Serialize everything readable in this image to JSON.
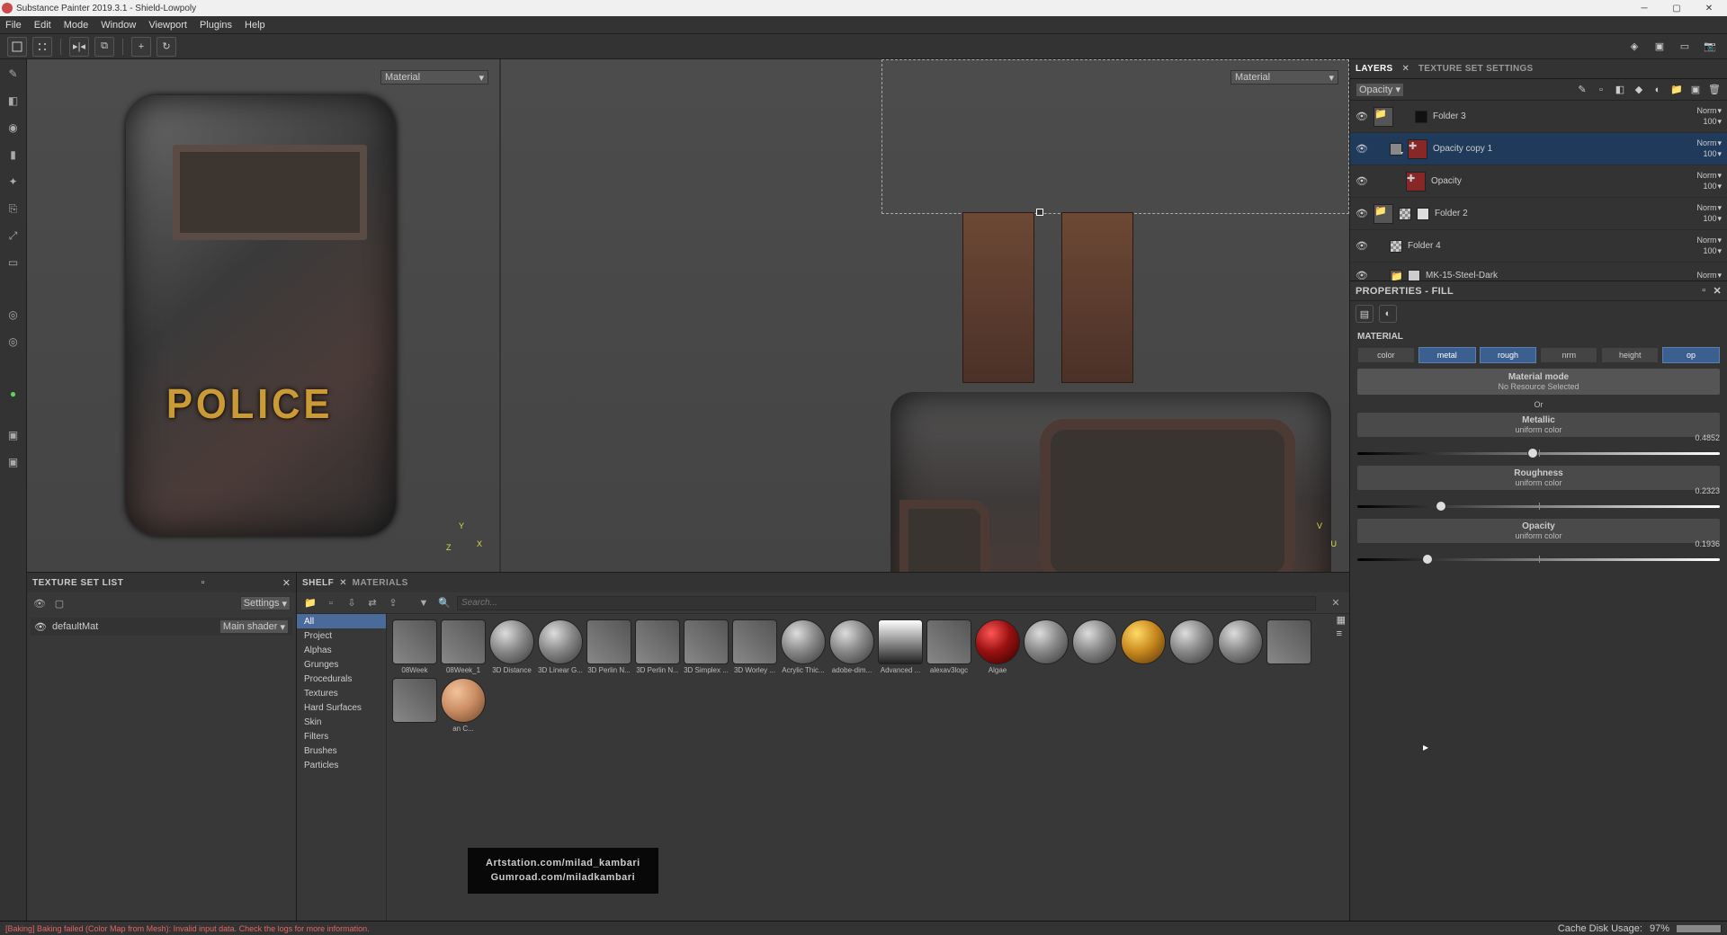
{
  "title_bar": {
    "title": "Substance Painter 2019.3.1 - Shield-Lowpoly"
  },
  "menu": [
    "File",
    "Edit",
    "Mode",
    "Window",
    "Viewport",
    "Plugins",
    "Help"
  ],
  "viewport": {
    "dropdown_left": "Material",
    "dropdown_right": "Material"
  },
  "right_tabs": {
    "layers": "LAYERS",
    "texset": "TEXTURE SET SETTINGS"
  },
  "blend_mode": "Opacity",
  "layers": [
    {
      "name": "Folder 3",
      "blend": "Norm",
      "opacity": "100",
      "type": "folder",
      "sel": false
    },
    {
      "name": "Opacity copy 1",
      "blend": "Norm",
      "opacity": "100",
      "type": "fill",
      "sel": true
    },
    {
      "name": "Opacity",
      "blend": "Norm",
      "opacity": "100",
      "type": "fill",
      "sel": false
    },
    {
      "name": "Folder 2",
      "blend": "Norm",
      "opacity": "100",
      "type": "folder",
      "sel": false
    },
    {
      "name": "Folder 4",
      "blend": "Norm",
      "opacity": "100",
      "type": "folder",
      "sel": false
    },
    {
      "name": "MK-15-Steel-Dark",
      "blend": "Norm",
      "opacity": "",
      "type": "folder",
      "sel": false
    }
  ],
  "properties": {
    "title": "PROPERTIES - FILL",
    "material_label": "MATERIAL",
    "channels": [
      {
        "label": "color",
        "active": false
      },
      {
        "label": "metal",
        "active": true
      },
      {
        "label": "rough",
        "active": true
      },
      {
        "label": "nrm",
        "active": false
      },
      {
        "label": "height",
        "active": false
      },
      {
        "label": "op",
        "active": true
      }
    ],
    "mat_mode_title": "Material mode",
    "mat_mode_sub": "No Resource Selected",
    "or": "Or",
    "metallic": {
      "title": "Metallic",
      "sub": "uniform color",
      "value": "0.4852",
      "pct": 48.52
    },
    "roughness": {
      "title": "Roughness",
      "sub": "uniform color",
      "value": "0.2323",
      "pct": 23.23
    },
    "opacity": {
      "title": "Opacity",
      "sub": "uniform color",
      "value": "0.1936",
      "pct": 19.36
    }
  },
  "texture_set": {
    "panel_title": "TEXTURE SET LIST",
    "settings": "Settings",
    "item": "defaultMat",
    "shader": "Main shader"
  },
  "shelf": {
    "tab1": "SHELF",
    "tab2": "MATERIALS",
    "search_placeholder": "Search...",
    "categories": [
      "All",
      "Project",
      "Alphas",
      "Grunges",
      "Procedurals",
      "Textures",
      "Hard Surfaces",
      "Skin",
      "Filters",
      "Brushes",
      "Particles"
    ],
    "items": [
      "08Week",
      "08Week_1",
      "3D Distance",
      "3D Linear G...",
      "3D Perlin N...",
      "3D Perlin N...",
      "3D Simplex ...",
      "3D Worley ...",
      "Acrylic Thic...",
      "adobe-dim...",
      "Advanced ...",
      "alexav3logc",
      "Algae",
      "",
      "",
      "",
      "",
      "",
      "",
      "",
      "an C..."
    ]
  },
  "overlay": {
    "line1": "Artstation.com/milad_kambari",
    "line2": "Gumroad.com/miladkambari"
  },
  "status": {
    "error": "[Baking] Baking failed (Color Map from Mesh): Invalid input data. Check the logs for more information.",
    "cache": "Cache Disk Usage:",
    "cache_val": "97%"
  },
  "shield_text": "POLICE",
  "axis": {
    "x": "X",
    "y": "Y",
    "z": "Z",
    "u": "U",
    "v": "V"
  }
}
